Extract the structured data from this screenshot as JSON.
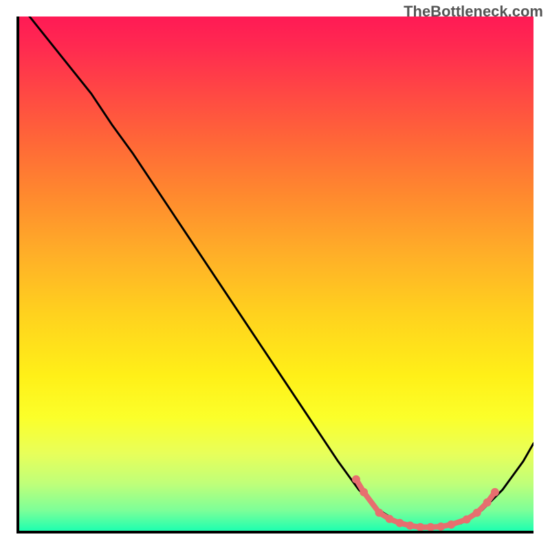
{
  "watermark": "TheBottleneck.com",
  "chart_data": {
    "type": "line",
    "title": "",
    "xlabel": "",
    "ylabel": "",
    "xlim": [
      0,
      100
    ],
    "ylim": [
      0,
      100
    ],
    "series": [
      {
        "name": "curve",
        "color": "#000000",
        "x": [
          2,
          6,
          10,
          14,
          18,
          22,
          26,
          30,
          34,
          38,
          42,
          46,
          50,
          54,
          58,
          62,
          66,
          70,
          74,
          78,
          82,
          86,
          90,
          94,
          98,
          100
        ],
        "y": [
          100,
          95,
          90,
          85,
          79,
          73.5,
          67.5,
          61.5,
          55.5,
          49.5,
          43.5,
          37.5,
          31.5,
          25.5,
          19.5,
          13.5,
          8,
          4,
          1.5,
          0.5,
          0.5,
          1.5,
          4,
          8,
          13.5,
          17
        ]
      },
      {
        "name": "markers",
        "color": "#e76f6f",
        "x": [
          65.5,
          67,
          70,
          72,
          74,
          76,
          78,
          80,
          82,
          84,
          87,
          89,
          91,
          92.5
        ],
        "y": [
          10,
          7.5,
          3.5,
          2.3,
          1.5,
          1.0,
          0.7,
          0.7,
          0.8,
          1.2,
          2.2,
          3.5,
          5.5,
          7.5
        ]
      }
    ]
  },
  "plot": {
    "inner_w": 752,
    "inner_h": 752
  }
}
